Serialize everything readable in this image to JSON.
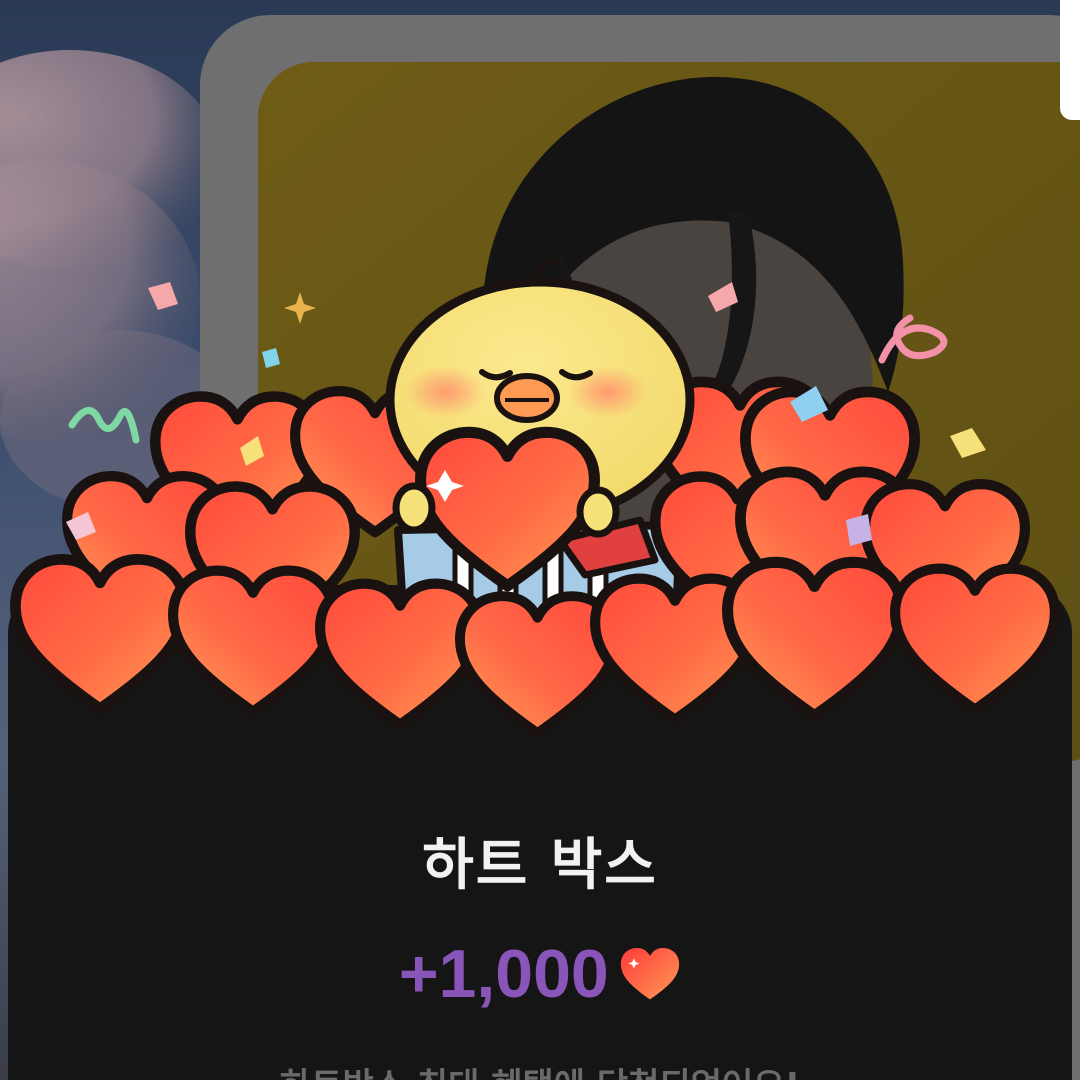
{
  "popup": {
    "title": "하트 박스",
    "reward_amount": "+1,000",
    "reward_icon": "heart-icon",
    "description": "하트박스 최대 혜택에 당첨되었어요!"
  },
  "colors": {
    "sheet_background": "#151515",
    "title_text": "#f2f2f2",
    "reward_text": "#8a55b8",
    "heart_fill": "#ff6b45",
    "character_body": "#f7e27a",
    "photo_background": "#6b5a18",
    "card_frame": "#6f6f6f"
  },
  "illustration": {
    "character": "yellow-chick-character",
    "object": "heart-box"
  }
}
